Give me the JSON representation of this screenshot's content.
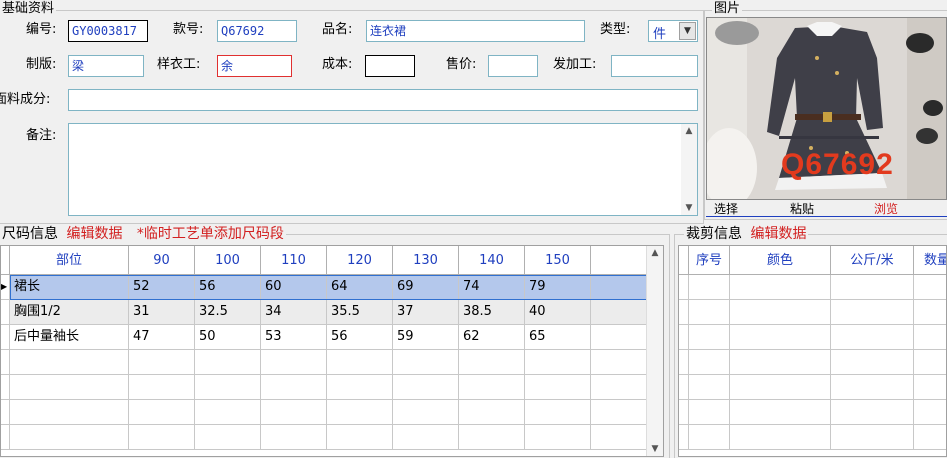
{
  "basic": {
    "legend": "基础资料",
    "fields": {
      "code_label": "编号:",
      "code_value": "GY0003817",
      "style_label": "款号:",
      "style_value": "Q67692",
      "name_label": "品名:",
      "name_value": "连衣裙",
      "type_label": "类型:",
      "type_value": "件",
      "pattern_label": "制版:",
      "pattern_value": "梁",
      "sample_label": "样衣工:",
      "sample_value": "余",
      "cost_label": "成本:",
      "cost_value": "",
      "price_label": "售价:",
      "price_value": "",
      "process_label": "发加工:",
      "process_value": "",
      "fabric_label": "面料成分:",
      "fabric_value": "",
      "remark_label": "备注:",
      "remark_value": ""
    }
  },
  "picture": {
    "legend": "图片",
    "caption": "Q67692",
    "buttons": [
      "选择",
      "粘贴",
      "浏览"
    ]
  },
  "size": {
    "legend": "尺码信息",
    "edit_label": "编辑数据",
    "note": "*临时工艺单添加尺码段",
    "columns": [
      "部位",
      "90",
      "100",
      "110",
      "120",
      "130",
      "140",
      "150"
    ],
    "rows": [
      [
        "裙长",
        "52",
        "56",
        "60",
        "64",
        "69",
        "74",
        "79"
      ],
      [
        "胸围1/2",
        "31",
        "32.5",
        "34",
        "35.5",
        "37",
        "38.5",
        "40"
      ],
      [
        "后中量袖长",
        "47",
        "50",
        "53",
        "56",
        "59",
        "62",
        "65"
      ]
    ],
    "selected_row": 0
  },
  "cut": {
    "legend": "裁剪信息",
    "edit_label": "编辑数据",
    "columns": [
      "序号",
      "颜色",
      "公斤/米",
      "数量"
    ]
  },
  "colors": {
    "accent_blue": "#1f3fbf",
    "accent_red": "#d22020",
    "selection": "#b4c8ec"
  }
}
